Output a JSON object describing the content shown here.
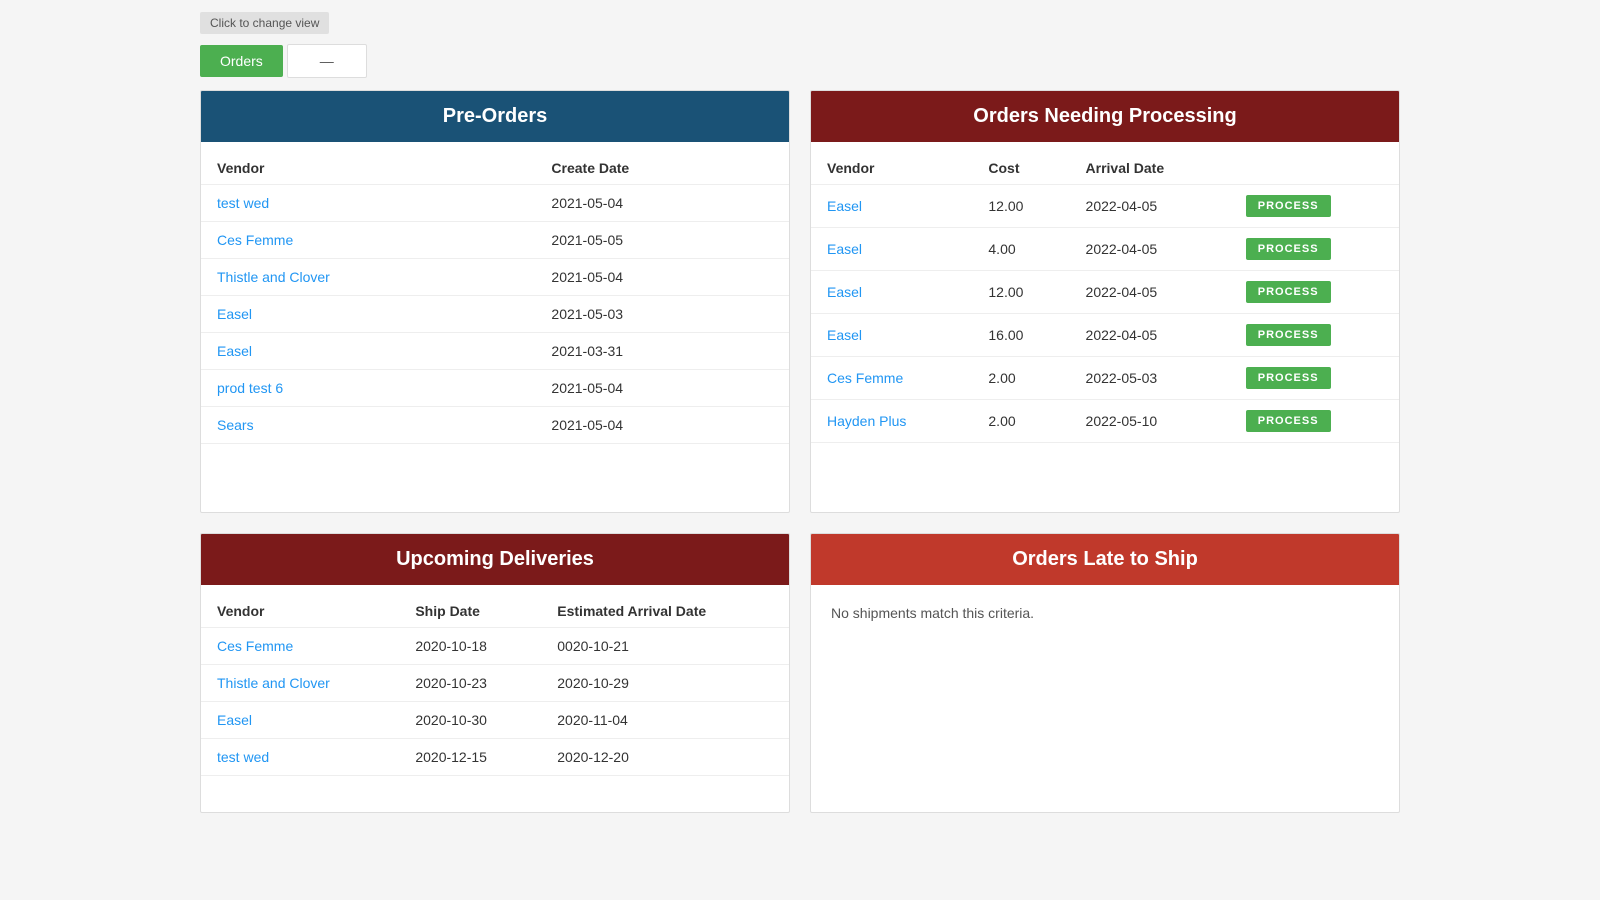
{
  "topBar": {
    "changeViewLabel": "Click to change view",
    "tabOrders": "Orders",
    "tabDash": "—"
  },
  "preOrders": {
    "title": "Pre-Orders",
    "columns": [
      "Vendor",
      "Create Date"
    ],
    "rows": [
      {
        "vendor": "test wed",
        "createDate": "2021-05-04"
      },
      {
        "vendor": "Ces Femme",
        "createDate": "2021-05-05"
      },
      {
        "vendor": "Thistle and Clover",
        "createDate": "2021-05-04"
      },
      {
        "vendor": "Easel",
        "createDate": "2021-05-03"
      },
      {
        "vendor": "Easel",
        "createDate": "2021-03-31"
      },
      {
        "vendor": "prod test 6",
        "createDate": "2021-05-04"
      },
      {
        "vendor": "Sears",
        "createDate": "2021-05-04"
      }
    ]
  },
  "ordersProcessing": {
    "title": "Orders Needing Processing",
    "columns": [
      "Vendor",
      "Cost",
      "Arrival Date",
      ""
    ],
    "processLabel": "PROCESS",
    "rows": [
      {
        "vendor": "Easel",
        "cost": "12.00",
        "arrivalDate": "2022-04-05"
      },
      {
        "vendor": "Easel",
        "cost": "4.00",
        "arrivalDate": "2022-04-05"
      },
      {
        "vendor": "Easel",
        "cost": "12.00",
        "arrivalDate": "2022-04-05"
      },
      {
        "vendor": "Easel",
        "cost": "16.00",
        "arrivalDate": "2022-04-05"
      },
      {
        "vendor": "Ces Femme",
        "cost": "2.00",
        "arrivalDate": "2022-05-03"
      },
      {
        "vendor": "Hayden Plus",
        "cost": "2.00",
        "arrivalDate": "2022-05-10"
      }
    ]
  },
  "upcomingDeliveries": {
    "title": "Upcoming Deliveries",
    "columns": [
      "Vendor",
      "Ship Date",
      "Estimated Arrival Date"
    ],
    "rows": [
      {
        "vendor": "Ces Femme",
        "shipDate": "2020-10-18",
        "estArrival": "0020-10-21"
      },
      {
        "vendor": "Thistle and Clover",
        "shipDate": "2020-10-23",
        "estArrival": "2020-10-29"
      },
      {
        "vendor": "Easel",
        "shipDate": "2020-10-30",
        "estArrival": "2020-11-04"
      },
      {
        "vendor": "test wed",
        "shipDate": "2020-12-15",
        "estArrival": "2020-12-20"
      }
    ]
  },
  "ordersLate": {
    "title": "Orders Late to Ship",
    "noMatchText": "No shipments match this criteria."
  }
}
